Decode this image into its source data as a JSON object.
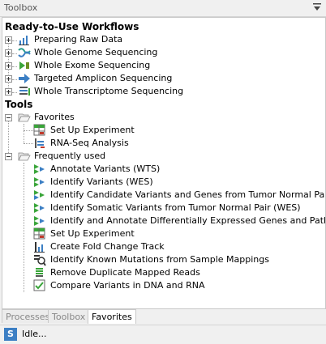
{
  "panel": {
    "title": "Toolbox",
    "menu_icon": "dropdown-triangle-icon"
  },
  "workflows": {
    "header": "Ready-to-Use Workflows",
    "items": [
      {
        "label": "Preparing Raw Data",
        "icon": "raw-data-chart-icon"
      },
      {
        "label": "Whole Genome Sequencing",
        "icon": "genome-icon"
      },
      {
        "label": "Whole Exome Sequencing",
        "icon": "exome-icon"
      },
      {
        "label": "Targeted Amplicon Sequencing",
        "icon": "amplicon-arrow-icon"
      },
      {
        "label": "Whole Transcriptome Sequencing",
        "icon": "transcriptome-icon"
      }
    ]
  },
  "tools": {
    "header": "Tools",
    "favorites": {
      "label": "Favorites",
      "items": [
        {
          "label": "Set Up Experiment",
          "icon": "experiment-table-icon"
        },
        {
          "label": "RNA-Seq Analysis",
          "icon": "rna-seq-icon"
        }
      ]
    },
    "frequent": {
      "label": "Frequently used",
      "items": [
        {
          "label": "Annotate Variants (WTS)",
          "icon": "variant-arrows-icon"
        },
        {
          "label": "Identify Variants (WES)",
          "icon": "variant-arrows-icon"
        },
        {
          "label": "Identify Candidate Variants and Genes from Tumor Normal Pair",
          "icon": "variant-pair-icon"
        },
        {
          "label": "Identify Somatic Variants from Tumor Normal Pair (WES)",
          "icon": "variant-arrows-icon"
        },
        {
          "label": "Identify and Annotate Differentially Expressed Genes and Pathways",
          "icon": "variant-arrows-icon"
        },
        {
          "label": "Set Up Experiment",
          "icon": "experiment-table-icon"
        },
        {
          "label": "Create Fold Change Track",
          "icon": "fold-change-icon"
        },
        {
          "label": "Identify Known Mutations from Sample Mappings",
          "icon": "known-mutations-icon"
        },
        {
          "label": "Remove Duplicate Mapped Reads",
          "icon": "duplicate-reads-icon"
        },
        {
          "label": "Compare Variants in DNA and RNA",
          "icon": "compare-variants-icon"
        }
      ]
    }
  },
  "tabs": [
    {
      "label": "Processes",
      "active": false
    },
    {
      "label": "Toolbox",
      "active": false
    },
    {
      "label": "Favorites",
      "active": true
    }
  ],
  "status": {
    "icon_letter": "S",
    "text": "Idle..."
  },
  "colors": {
    "accent_blue": "#3c7fc4",
    "green": "#3aa53a",
    "red": "#c0392b"
  }
}
